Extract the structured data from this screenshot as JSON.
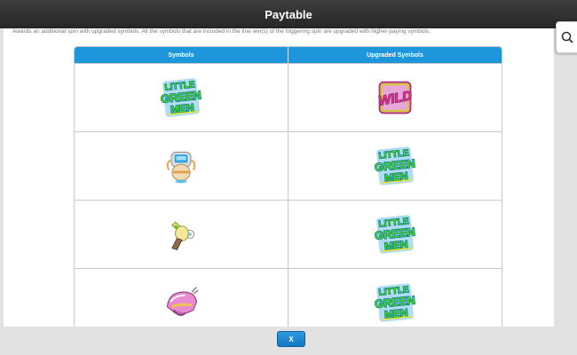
{
  "header": {
    "title": "Paytable"
  },
  "description": "Awards an additional spin with upgraded symbols. All the symbols that are included in the line win(s) of the triggering spin are upgraded with higher-paying symbols.",
  "table": {
    "columns": [
      "Symbols",
      "Upgraded Symbols"
    ],
    "rows": [
      {
        "symbol": "little-green-men-symbol",
        "upgraded": "wild-symbol",
        "upgraded_text": "WILD"
      },
      {
        "symbol": "robot-symbol",
        "upgraded": "little-green-men-symbol"
      },
      {
        "symbol": "ray-gun-symbol",
        "upgraded": "little-green-men-symbol"
      },
      {
        "symbol": "helmet-symbol",
        "upgraded": "little-green-men-symbol"
      }
    ]
  },
  "logo_text": [
    "LITTLE",
    "GREEN",
    "MEN"
  ],
  "side_tab": {
    "icon": "search-icon"
  },
  "close_button": {
    "label": "X"
  },
  "colors": {
    "header_bg": "#2f2f2f",
    "table_header": "#1e96dc",
    "logo_green": "#3fd62a",
    "wild_pink": "#e0338f",
    "button_blue": "#1e88d6"
  }
}
